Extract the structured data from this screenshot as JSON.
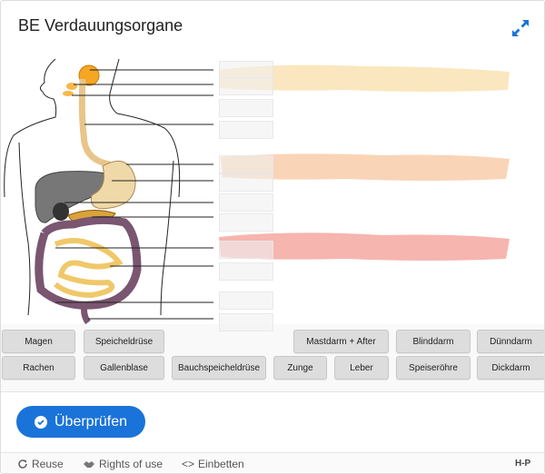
{
  "header": {
    "title": "BE Verdauungsorgane"
  },
  "draggables": [
    "Magen",
    "Speicheldrüse",
    "Mastdarm + After",
    "Blinddarm",
    "Dünndarm",
    "Rachen",
    "Gallenblase",
    "Bauchspeicheldrüse",
    "Zunge",
    "Leber",
    "Speiseröhre",
    "Dickdarm"
  ],
  "actions": {
    "check_label": "Überprüfen"
  },
  "footer": {
    "reuse_label": "Reuse",
    "rights_label": "Rights of use",
    "embed_label": "Einbetten",
    "logo_text": "H-P"
  },
  "colors": {
    "accent": "#1a73d9",
    "stroke_yellow": "#f9e3b4",
    "stroke_orange": "#f9ccaa",
    "stroke_red": "#f4a8a0"
  }
}
